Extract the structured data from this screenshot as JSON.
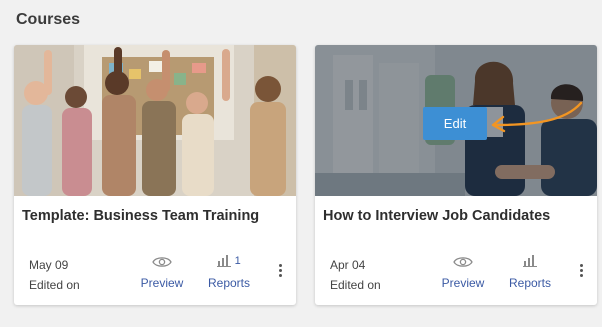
{
  "section": {
    "title": "Courses"
  },
  "courses": [
    {
      "title": "Template: Business Team Training",
      "date": "May 09",
      "edited_label": "Edited on",
      "preview_label": "Preview",
      "reports_label": "Reports",
      "reports_count": "1"
    },
    {
      "title": "How to Interview Job Candidates",
      "date": "Apr 04",
      "edited_label": "Edited on",
      "preview_label": "Preview",
      "reports_label": "Reports",
      "edit_label": "Edit"
    }
  ],
  "colors": {
    "accent_link": "#3b5aa4",
    "edit_button": "#3d8fd4",
    "arrow": "#f29522"
  }
}
